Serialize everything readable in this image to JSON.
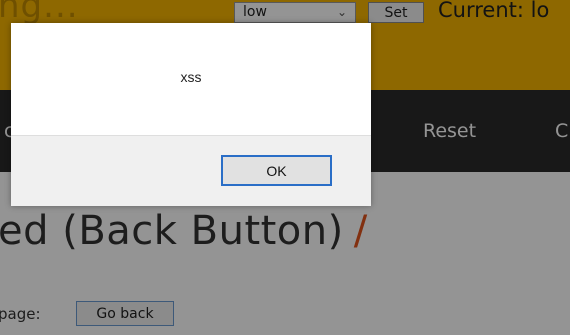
{
  "header": {
    "brand_fragment": "ng...",
    "security_select_value": "low",
    "set_label": "Set",
    "current_label": "Current: lo"
  },
  "nav": {
    "left_fragment": "c",
    "reset_label": "Reset",
    "right_fragment": "C"
  },
  "content": {
    "heading": "ed (Back Button)",
    "heading_slash": "/",
    "back_prompt": "page:",
    "go_back_label": "Go back"
  },
  "dialog": {
    "message": "xss",
    "ok_label": "OK"
  },
  "colors": {
    "header_bg": "#f4b400",
    "nav_bg": "#2a2a2a",
    "accent": "#e0541c",
    "dialog_button_border": "#2a6ec7"
  }
}
